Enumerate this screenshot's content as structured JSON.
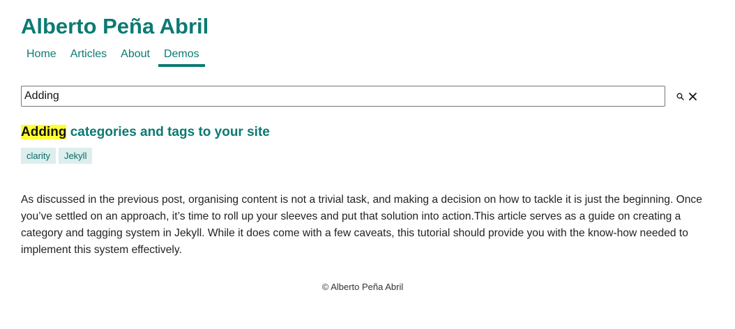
{
  "site": {
    "title": "Alberto Peña Abril"
  },
  "nav": {
    "items": [
      {
        "label": "Home",
        "active": false
      },
      {
        "label": "Articles",
        "active": false
      },
      {
        "label": "About",
        "active": false
      },
      {
        "label": "Demos",
        "active": true
      }
    ]
  },
  "search": {
    "value": "Adding",
    "search_icon": "magnifier-icon",
    "clear_icon": "close-icon"
  },
  "results": [
    {
      "title_highlight": "Adding",
      "title_rest": " categories and tags to your site",
      "tags": [
        "clarity",
        "Jekyll"
      ],
      "excerpt": "As discussed in the previous post, organising content is not a trivial task, and making a decision on how to tackle it is just the beginning. Once you’ve settled on an approach, it’s time to roll up your sleeves and put that solution into action.This article serves as a guide on creating a category and tagging system in Jekyll. While it does come with a few caveats, this tutorial should provide you with the know-how needed to implement this system effectively."
    }
  ],
  "footer": {
    "text": "© Alberto Peña Abril"
  },
  "colors": {
    "accent": "#0b7a72",
    "highlight": "#ffff33",
    "tag_bg": "#dceeed"
  }
}
